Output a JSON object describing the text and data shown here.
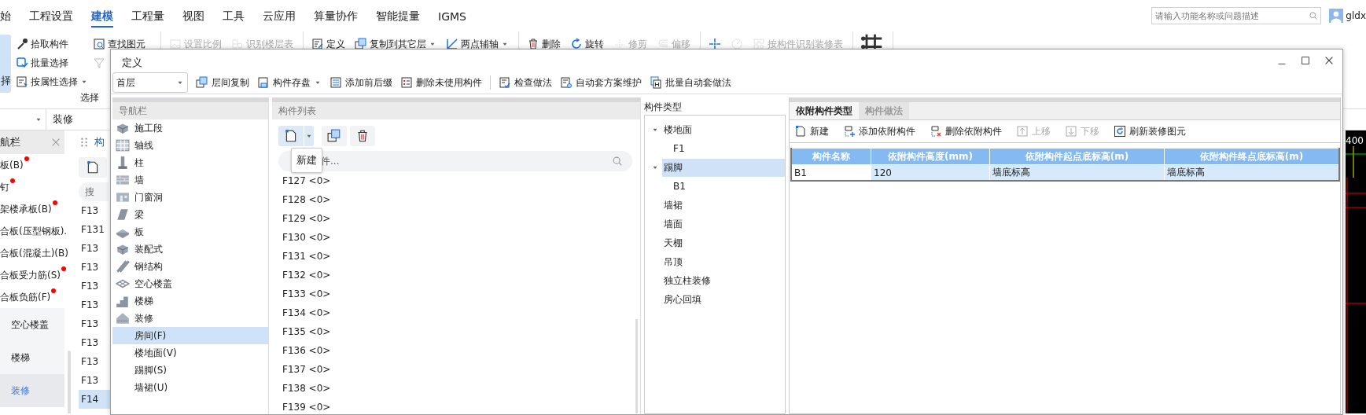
{
  "menu": [
    {
      "label": "始",
      "selected": false
    },
    {
      "label": "工程设置",
      "selected": false
    },
    {
      "label": "建模",
      "selected": true
    },
    {
      "label": "工程量",
      "selected": false
    },
    {
      "label": "视图",
      "selected": false
    },
    {
      "label": "工具",
      "selected": false
    },
    {
      "label": "云应用",
      "selected": false
    },
    {
      "label": "算量协作",
      "selected": false
    },
    {
      "label": "智能提量",
      "selected": false
    },
    {
      "label": "IGMS",
      "selected": false
    }
  ],
  "search": {
    "placeholder": "请输入功能名称或问题描述"
  },
  "user": {
    "name": "gldx"
  },
  "ribbon": {
    "side_button": {
      "label": "择"
    },
    "select_group": {
      "label": "选择",
      "columns": [
        [
          {
            "label": "拾取构件",
            "dropdown": false
          },
          {
            "label": "批量选择",
            "dropdown": false
          },
          {
            "label": "按属性选择",
            "dropdown": true
          }
        ],
        [
          {
            "label": "查找图元",
            "dropdown": false
          }
        ]
      ]
    },
    "groups": [
      [
        {
          "label": "设置比例",
          "disabled": true,
          "dropdown": false
        },
        {
          "label": "识别楼层表",
          "disabled": true,
          "dropdown": false
        }
      ],
      [
        {
          "label": "定义",
          "disabled": false,
          "dropdown": false
        },
        {
          "label": "复制到其它层",
          "disabled": false,
          "dropdown": true
        },
        {
          "label": "两点辅轴",
          "disabled": false,
          "dropdown": true
        }
      ],
      [
        {
          "label": "删除",
          "disabled": false,
          "dropdown": false
        },
        {
          "label": "旋转",
          "disabled": false,
          "dropdown": false
        },
        {
          "label": "修剪",
          "disabled": true,
          "dropdown": false
        },
        {
          "label": "偏移",
          "disabled": true,
          "dropdown": false
        }
      ],
      [
        {
          "disabled": false,
          "dropdown": false
        },
        {
          "disabled": true,
          "dropdown": false
        },
        {
          "label": "按构件识别装修表",
          "disabled": true,
          "dropdown": false
        }
      ],
      [
        {
          "disabled": false,
          "dropdown": false
        }
      ]
    ]
  },
  "sub_bar": {
    "label": "装修"
  },
  "side_nav": {
    "title": "航栏",
    "items": [
      {
        "label": "板(B)",
        "marked": true
      },
      {
        "label": "钉",
        "marked": true
      },
      {
        "label": "架楼承板(B)",
        "marked": true
      },
      {
        "label": "合板(压型钢板).",
        "marked": false
      },
      {
        "label": "合板(混凝土)(B)",
        "marked": false
      },
      {
        "label": "合板受力筋(S)",
        "marked": true
      },
      {
        "label": "合板负筋(F)",
        "marked": true
      }
    ],
    "sections": [
      {
        "label": "空心楼盖",
        "selected": false
      },
      {
        "label": "楼梯",
        "selected": false
      },
      {
        "label": "装修",
        "selected": true
      }
    ]
  },
  "side_list": {
    "tab": "构",
    "placeholder": "搜",
    "rows": [
      {
        "label": "F13",
        "selected": false
      },
      {
        "label": "F131",
        "selected": false
      },
      {
        "label": "F13",
        "selected": false
      },
      {
        "label": "F13",
        "selected": false
      },
      {
        "label": "F13",
        "selected": false
      },
      {
        "label": "F13",
        "selected": false
      },
      {
        "label": "F13",
        "selected": false
      },
      {
        "label": "F13",
        "selected": false
      },
      {
        "label": "F13",
        "selected": false
      },
      {
        "label": "F13",
        "selected": false
      },
      {
        "label": "F14",
        "selected": true
      }
    ]
  },
  "cad": {
    "label": "400"
  },
  "dialog": {
    "title": "定义",
    "floor": {
      "value": "首层"
    },
    "toolbar": [
      {
        "label": "层间复制",
        "dropdown": false
      },
      {
        "label": "构件存盘",
        "dropdown": true
      },
      {
        "label": "添加前后缀",
        "dropdown": false
      },
      {
        "label": "删除未使用构件",
        "dropdown": false
      },
      {
        "label": "检查做法",
        "dropdown": false
      },
      {
        "label": "自动套方案维护",
        "dropdown": false
      },
      {
        "label": "批量自动套做法",
        "dropdown": false
      }
    ],
    "nav": {
      "title": "导航栏",
      "items": [
        {
          "label": "施工段",
          "selected": false
        },
        {
          "label": "轴线",
          "selected": false
        },
        {
          "label": "柱",
          "selected": false
        },
        {
          "label": "墙",
          "selected": false
        },
        {
          "label": "门窗洞",
          "selected": false
        },
        {
          "label": "梁",
          "selected": false
        },
        {
          "label": "板",
          "selected": false
        },
        {
          "label": "装配式",
          "selected": false
        },
        {
          "label": "钢结构",
          "selected": false
        },
        {
          "label": "空心楼盖",
          "selected": false
        },
        {
          "label": "楼梯",
          "selected": false
        },
        {
          "label": "装修",
          "selected": false,
          "children": [
            {
              "label": "房间(F)",
              "selected": true
            },
            {
              "label": "楼地面(V)",
              "selected": false
            },
            {
              "label": "踢脚(S)",
              "selected": false
            },
            {
              "label": "墙裙(U)",
              "selected": false
            }
          ]
        }
      ]
    },
    "list": {
      "title": "构件列表",
      "tooltip": "新建",
      "search": {
        "placeholder": "件..."
      },
      "rows": [
        {
          "label": "F127 <0>",
          "selected": false
        },
        {
          "label": "F128 <0>",
          "selected": false
        },
        {
          "label": "F129 <0>",
          "selected": false
        },
        {
          "label": "F130 <0>",
          "selected": false
        },
        {
          "label": "F131 <0>",
          "selected": false
        },
        {
          "label": "F132 <0>",
          "selected": false
        },
        {
          "label": "F133 <0>",
          "selected": false
        },
        {
          "label": "F134 <0>",
          "selected": false
        },
        {
          "label": "F135 <0>",
          "selected": false
        },
        {
          "label": "F136 <0>",
          "selected": false
        },
        {
          "label": "F137 <0>",
          "selected": false
        },
        {
          "label": "F138 <0>",
          "selected": false
        },
        {
          "label": "F139 <0>",
          "selected": false
        }
      ]
    },
    "types": {
      "title": "构件类型",
      "items": [
        {
          "label": "楼地面",
          "expanded": true,
          "selected": false,
          "children": [
            {
              "label": "F1",
              "selected": false
            }
          ]
        },
        {
          "label": "踢脚",
          "expanded": true,
          "selected": true,
          "children": [
            {
              "label": "B1",
              "selected": false
            }
          ]
        },
        {
          "label": "墙裙",
          "selected": false
        },
        {
          "label": "墙面",
          "selected": false
        },
        {
          "label": "天棚",
          "selected": false
        },
        {
          "label": "吊顶",
          "selected": false
        },
        {
          "label": "独立柱装修",
          "selected": false
        },
        {
          "label": "房心回填",
          "selected": false
        }
      ]
    },
    "detail": {
      "tabs": [
        {
          "label": "依附构件类型",
          "selected": true
        },
        {
          "label": "构件做法",
          "selected": false
        }
      ],
      "toolbar": [
        {
          "label": "新建",
          "disabled": false
        },
        {
          "label": "添加依附构件",
          "disabled": false
        },
        {
          "label": "删除依附构件",
          "disabled": false
        },
        {
          "label": "上移",
          "disabled": true
        },
        {
          "label": "下移",
          "disabled": true
        },
        {
          "label": "刷新装修图元",
          "disabled": false
        }
      ],
      "table": {
        "columns": [
          "构件名称",
          "依附构件高度(mm)",
          "依附构件起点底标高(m)",
          "依附构件终点底标高(m)"
        ],
        "rows": [
          {
            "cells": [
              "B1",
              "120",
              "墙底标高",
              "墙底标高"
            ],
            "selected": true
          }
        ]
      }
    }
  }
}
